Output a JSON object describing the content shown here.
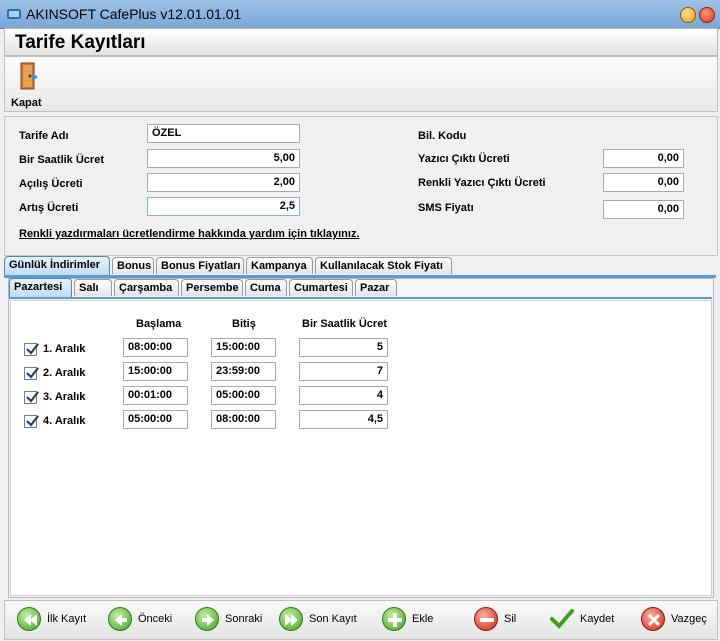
{
  "window": {
    "title": "AKINSOFT CafePlus v12.01.01.01"
  },
  "page": {
    "title": "Tarife Kayıtları"
  },
  "toolbar": {
    "close_label": "Kapat"
  },
  "form": {
    "tariff_name_label": "Tarife Adı",
    "tariff_name_value": "ÖZEL",
    "hourly_fee_label": "Bir Saatlik Ücret",
    "hourly_fee_value": "5,00",
    "opening_fee_label": "Açılış Ücreti",
    "opening_fee_value": "2,00",
    "increase_fee_label": "Artış Ücreti",
    "increase_fee_value": "2,5",
    "bil_code_label": "Bil. Kodu",
    "printer_fee_label": "Yazıcı Çıktı Ücreti",
    "printer_fee_value": "0,00",
    "color_printer_fee_label": "Renkli Yazıcı Çıktı Ücreti",
    "color_printer_fee_value": "0,00",
    "sms_price_label": "SMS Fiyatı",
    "sms_price_value": "0,00",
    "help_link": "Renkli yazdırmaları ücretlendirme hakkında yardım için tıklayınız."
  },
  "tabs": [
    {
      "label": "Günlük İndirimler",
      "active": true
    },
    {
      "label": "Bonus"
    },
    {
      "label": "Bonus Fiyatları"
    },
    {
      "label": "Kampanya"
    },
    {
      "label": "Kullanılacak Stok Fiyatı"
    }
  ],
  "subtabs": [
    {
      "label": "Pazartesi",
      "active": true
    },
    {
      "label": "Salı"
    },
    {
      "label": "Çarşamba"
    },
    {
      "label": "Persembe"
    },
    {
      "label": "Cuma"
    },
    {
      "label": "Cumartesi"
    },
    {
      "label": "Pazar"
    }
  ],
  "intervals": {
    "headers": {
      "start": "Başlama",
      "end": "Bitiş",
      "fee": "Bir Saatlik Ücret"
    },
    "rows": [
      {
        "checked": true,
        "label": "1. Aralık",
        "start": "08:00:00",
        "end": "15:00:00",
        "fee": "5"
      },
      {
        "checked": true,
        "label": "2. Aralık",
        "start": "15:00:00",
        "end": "23:59:00",
        "fee": "7"
      },
      {
        "checked": true,
        "label": "3. Aralık",
        "start": "00:01:00",
        "end": "05:00:00",
        "fee": "4"
      },
      {
        "checked": true,
        "label": "4. Aralık",
        "start": "05:00:00",
        "end": "08:00:00",
        "fee": "4,5"
      }
    ]
  },
  "bottom": {
    "first": "İlk Kayıt",
    "prev": "Önceki",
    "next": "Sonraki",
    "last": "Son Kayıt",
    "add": "Ekle",
    "delete": "Sil",
    "save": "Kaydet",
    "cancel": "Vazgeç"
  },
  "colors": {
    "accent": "#5c9ad6",
    "titlebar": "#8cb6e2"
  }
}
